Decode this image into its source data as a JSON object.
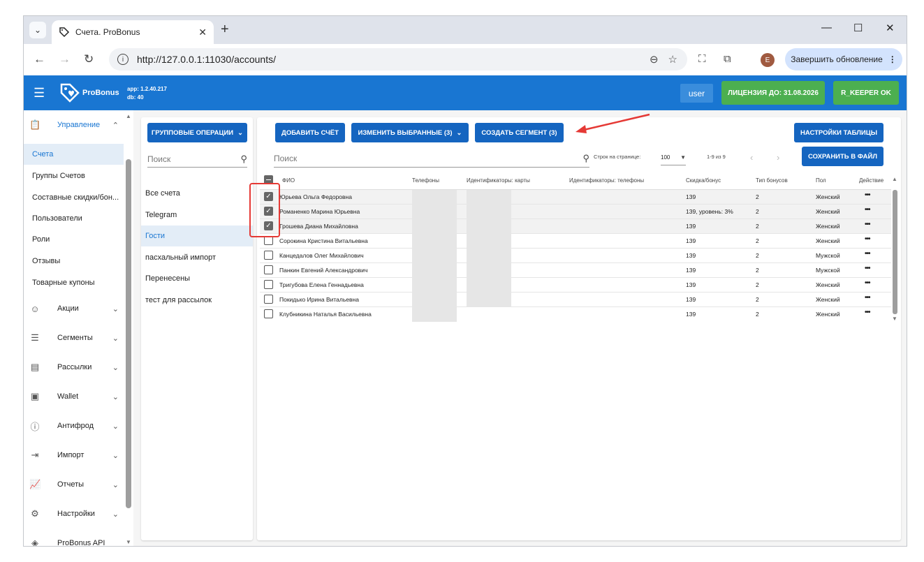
{
  "browser": {
    "tab_title": "Счета. ProBonus",
    "url": "http://127.0.0.1:11030/accounts/",
    "avatar_letter": "E",
    "update_button": "Завершить обновление",
    "new_tab": "+",
    "tab_close": "✕"
  },
  "appbar": {
    "logo_text": "ProBonus",
    "version_app": "app: 1.2.40.217",
    "version_db": "db: 40",
    "user": "user",
    "license": "ЛИЦЕНЗИЯ ДО: 31.08.2026",
    "rkeeper": "R_KEEPER OK",
    "colors": {
      "appbar": "#1976d2",
      "ok": "#4caf50"
    }
  },
  "sidebar": {
    "management": "Управление",
    "items": [
      "Счета",
      "Группы Счетов",
      "Составные скидки/бон...",
      "Пользователи",
      "Роли",
      "Отзывы",
      "Товарные купоны"
    ],
    "active_item": "Счета",
    "sections": [
      {
        "label": "Акции",
        "icon": "smile-icon"
      },
      {
        "label": "Сегменты",
        "icon": "filter-list-icon"
      },
      {
        "label": "Рассылки",
        "icon": "mail-icon"
      },
      {
        "label": "Wallet",
        "icon": "wallet-icon"
      },
      {
        "label": "Антифрод",
        "icon": "alert-circle-icon"
      },
      {
        "label": "Импорт",
        "icon": "login-icon"
      },
      {
        "label": "Отчеты",
        "icon": "chart-icon"
      },
      {
        "label": "Настройки",
        "icon": "gear-icon"
      },
      {
        "label": "ProBonus API",
        "icon": "api-icon"
      }
    ]
  },
  "groups": {
    "button": "ГРУППОВЫЕ ОПЕРАЦИИ",
    "search_placeholder": "Поиск",
    "items": [
      "Все счета",
      "Telegram",
      "Гости",
      "пасхальный импорт",
      "Перенесены",
      "тест для рассылок"
    ],
    "active": "Гости"
  },
  "toolbar": {
    "add": "ДОБАВИТЬ СЧЁТ",
    "edit_selected": "ИЗМЕНИТЬ ВЫБРАННЫЕ (3)",
    "create_segment": "СОЗДАТЬ СЕГМЕНТ (3)",
    "table_settings": "НАСТРОЙКИ ТАБЛИЦЫ",
    "save_file": "СОХРАНИТЬ В ФАЙЛ",
    "search_placeholder": "Поиск",
    "rows_per_page_label": "Строк на странице:",
    "rows_per_page": "100",
    "range": "1-9 из 9"
  },
  "table": {
    "columns": [
      "ФИО",
      "Телефоны",
      "Идентификаторы: карты",
      "Идентификаторы: телефоны",
      "Скидка/бонус",
      "Тип бонусов",
      "Пол",
      "Действие"
    ],
    "rows": [
      {
        "name": "Юрьева Ольга Федоровна",
        "discount": "139",
        "type": "2",
        "gender": "Женский",
        "checked": true
      },
      {
        "name": "Романенко Марина Юрьевна",
        "discount": "139, уровень: 3%",
        "type": "2",
        "gender": "Женский",
        "checked": true
      },
      {
        "name": "Грошева Диана Михайловна",
        "discount": "139",
        "type": "2",
        "gender": "Женский",
        "checked": true
      },
      {
        "name": "Сорокина Кристина Витальевна",
        "discount": "139",
        "type": "2",
        "gender": "Женский",
        "checked": false
      },
      {
        "name": "Канцедалов Олег Михайлович",
        "discount": "139",
        "type": "2",
        "gender": "Мужской",
        "checked": false
      },
      {
        "name": "Панкин Евгений Александрович",
        "discount": "139",
        "type": "2",
        "gender": "Мужской",
        "checked": false
      },
      {
        "name": "Тригубова Елена Геннадьевна",
        "discount": "139",
        "type": "2",
        "gender": "Женский",
        "checked": false
      },
      {
        "name": "Покидько Ирина Витальевна",
        "discount": "139",
        "type": "2",
        "gender": "Женский",
        "checked": false
      },
      {
        "name": "Клубникина Наталья Васильевна",
        "discount": "139",
        "type": "2",
        "gender": "Женский",
        "checked": false
      }
    ],
    "action_glyph": "•••",
    "check_glyph": "✓"
  }
}
